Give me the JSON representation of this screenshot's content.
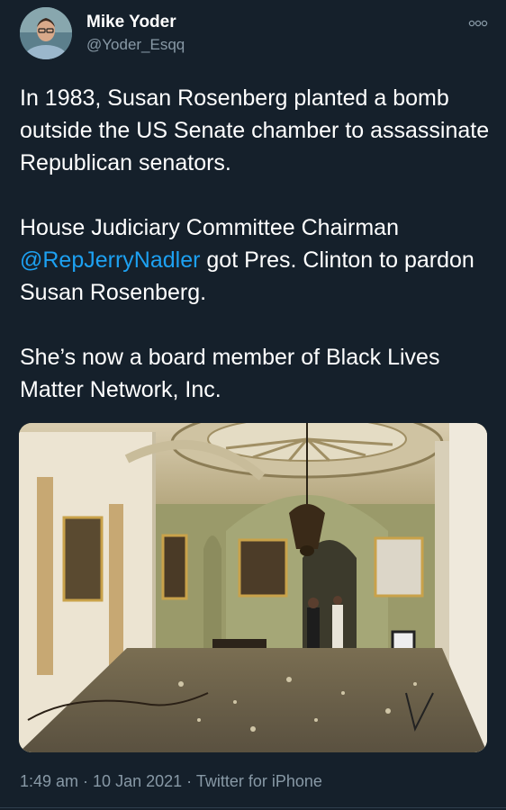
{
  "tweet": {
    "author_name": "Mike Yoder",
    "author_handle": "@Yoder_Esqq",
    "paragraph1": "In 1983, Susan Rosenberg planted a bomb outside the US Senate chamber to assassinate Republican senators.",
    "paragraph2_before": "House Judiciary Committee Chairman",
    "paragraph2_mention": "@RepJerryNadler",
    "paragraph2_after": " got Pres. Clinton to pardon Susan Rosenberg.",
    "paragraph3": "She’s now a board member of Black Lives Matter Network, Inc.",
    "time": "1:49 am",
    "sep1": " · ",
    "date": "10 Jan 2021",
    "sep2": " · ",
    "source": "Twitter for iPhone"
  },
  "icons": {
    "more": "more-options-icon"
  },
  "colors": {
    "background": "#15202b",
    "text": "#ffffff",
    "secondary_text": "#8899a6",
    "link": "#1da1f2"
  }
}
